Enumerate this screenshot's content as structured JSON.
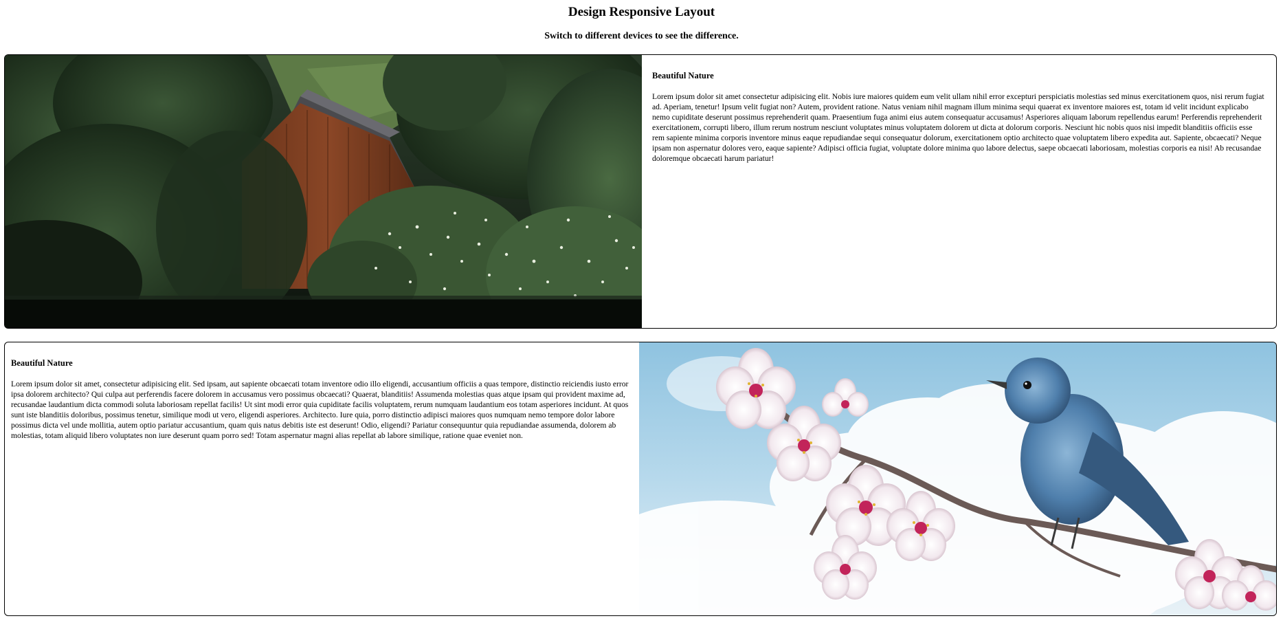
{
  "header": {
    "title": "Design Responsive Layout",
    "subtitle": "Switch to different devices to see the difference."
  },
  "cards": [
    {
      "heading": "Beautiful Nature",
      "body": "Lorem ipsum dolor sit amet consectetur adipisicing elit. Nobis iure maiores quidem eum velit ullam nihil error excepturi perspiciatis molestias sed minus exercitationem quos, nisi rerum fugiat ad. Aperiam, tenetur! Ipsum velit fugiat non? Autem, provident ratione. Natus veniam nihil magnam illum minima sequi quaerat ex inventore maiores est, totam id velit incidunt explicabo nemo cupiditate deserunt possimus reprehenderit quam. Praesentium fuga animi eius autem consequatur accusamus! Asperiores aliquam laborum repellendus earum! Perferendis reprehenderit exercitationem, corrupti libero, illum rerum nostrum nesciunt voluptates minus voluptatem dolorem ut dicta at dolorum corporis. Nesciunt hic nobis quos nisi impedit blanditiis officiis esse rem sapiente minima corporis inventore minus eaque repudiandae sequi consequatur dolorum, exercitationem optio architecto quae voluptatem libero expedita aut. Sapiente, obcaecati? Neque ipsam non aspernatur dolores vero, eaque sapiente? Adipisci officia fugiat, voluptate dolore minima quo labore delectus, saepe obcaecati laboriosam, molestias corporis ea nisi! Ab recusandae doloremque obcaecati harum pariatur!"
    },
    {
      "heading": "Beautiful Nature",
      "body": "Lorem ipsum dolor sit amet, consectetur adipisicing elit. Sed ipsam, aut sapiente obcaecati totam inventore odio illo eligendi, accusantium officiis a quas tempore, distinctio reiciendis iusto error ipsa dolorem architecto? Qui culpa aut perferendis facere dolorem in accusamus vero possimus obcaecati? Quaerat, blanditiis! Assumenda molestias quas atque ipsam qui provident maxime ad, recusandae laudantium dicta commodi soluta laboriosam repellat facilis! Ut sint modi error quia cupiditate facilis voluptatem, rerum numquam laudantium eos totam asperiores incidunt. At quos sunt iste blanditiis doloribus, possimus tenetur, similique modi ut vero, eligendi asperiores. Architecto. Iure quia, porro distinctio adipisci maiores quos numquam nemo tempore dolor labore possimus dicta vel unde mollitia, autem optio pariatur accusantium, quam quis natus debitis iste est deserunt! Odio, eligendi? Pariatur consequuntur quia repudiandae assumenda, dolorem ab molestias, totam aliquid libero voluptates non iure deserunt quam porro sed! Totam aspernatur magni alias repellat ab labore similique, ratione quae eveniet non."
    }
  ],
  "images": {
    "forest_cabin": "forest-cabin-photo",
    "bird_blossom": "bird-on-blossom-photo"
  }
}
